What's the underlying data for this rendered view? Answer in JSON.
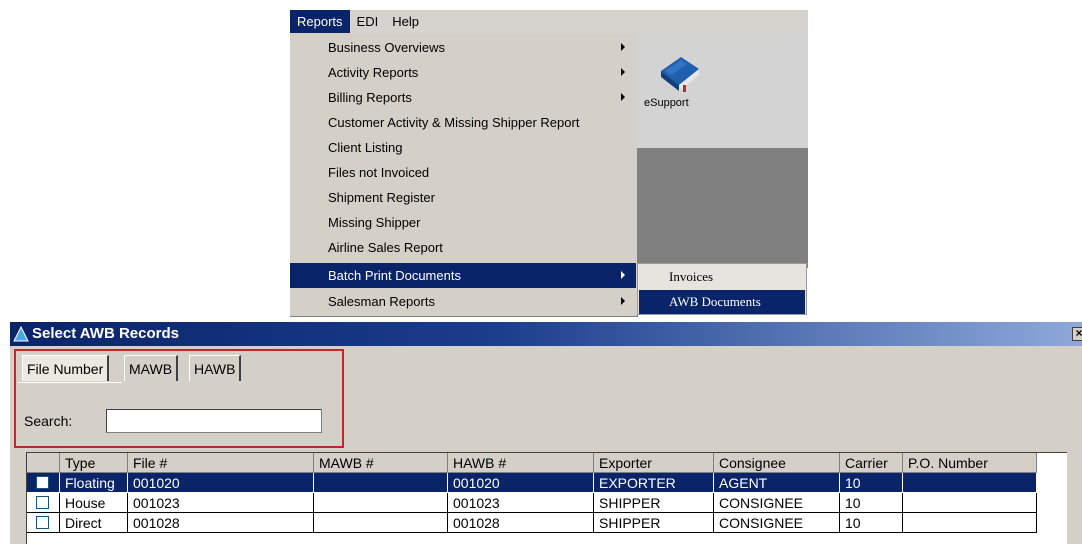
{
  "menubar": {
    "items": [
      {
        "label": "Reports",
        "active": true
      },
      {
        "label": "EDI",
        "active": false
      },
      {
        "label": "Help",
        "active": false
      }
    ]
  },
  "reports_menu": {
    "items": [
      {
        "label": "Business Overviews",
        "submenu": true
      },
      {
        "label": "Activity Reports",
        "submenu": true
      },
      {
        "label": "Billing Reports",
        "submenu": true
      },
      {
        "label": "Customer Activity & Missing Shipper Report",
        "submenu": false
      },
      {
        "label": "Client Listing",
        "submenu": false
      },
      {
        "label": "Files not Invoiced",
        "submenu": false
      },
      {
        "label": "Shipment Register",
        "submenu": false
      },
      {
        "label": "Missing Shipper",
        "submenu": false
      },
      {
        "label": "Airline Sales Report",
        "submenu": false
      },
      {
        "label": "Batch Print Documents",
        "submenu": true,
        "highlighted": true
      },
      {
        "label": "Salesman Reports",
        "submenu": true
      }
    ]
  },
  "batch_submenu": {
    "items": [
      {
        "label": "Invoices"
      },
      {
        "label": "AWB Documents",
        "highlighted": true
      }
    ]
  },
  "app_panel": {
    "esupport_label": "eSupport",
    "icon": "book-icon"
  },
  "dialog": {
    "title": "Select AWB Records",
    "close_label": "×",
    "tabs": [
      {
        "label": "File Number",
        "active": true
      },
      {
        "label": "MAWB",
        "active": false
      },
      {
        "label": "HAWB",
        "active": false
      }
    ],
    "search": {
      "label": "Search:",
      "value": "",
      "placeholder": ""
    },
    "grid": {
      "columns": [
        "",
        "Type",
        "File #",
        "MAWB #",
        "HAWB #",
        "Exporter",
        "Consignee",
        "Carrier",
        "P.O. Number"
      ],
      "rows": [
        {
          "type": "Floating",
          "file": "001020",
          "mawb": "",
          "hawb": "001020",
          "exporter": "EXPORTER",
          "consignee": "AGENT",
          "carrier": "10",
          "po": "",
          "selected": true
        },
        {
          "type": "House",
          "file": "001023",
          "mawb": "",
          "hawb": "001023",
          "exporter": "SHIPPER",
          "consignee": "CONSIGNEE",
          "carrier": "10",
          "po": "",
          "selected": false
        },
        {
          "type": "Direct",
          "file": "001028",
          "mawb": "",
          "hawb": "001028",
          "exporter": "SHIPPER",
          "consignee": "CONSIGNEE",
          "carrier": "10",
          "po": "",
          "selected": false
        }
      ]
    }
  },
  "colors": {
    "highlight": "#0a246a",
    "menu_bg": "#d4d0c8",
    "annotation_red": "#c0272d"
  }
}
